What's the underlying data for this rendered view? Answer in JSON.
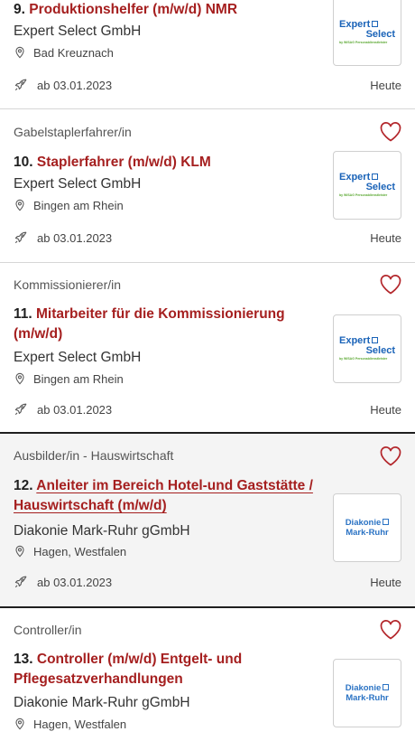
{
  "jobs": [
    {
      "category": "",
      "number": "9.",
      "title": "Produktionshelfer (m/w/d) NMR",
      "company": "Expert Select GmbH",
      "location": "Bad Kreuznach",
      "start": "ab 03.01.2023",
      "posted": "Heute",
      "logo_type": "expert-select"
    },
    {
      "category": "Gabelstaplerfahrer/in",
      "number": "10.",
      "title": "Staplerfahrer (m/w/d) KLM",
      "company": "Expert Select GmbH",
      "location": "Bingen am Rhein",
      "start": "ab 03.01.2023",
      "posted": "Heute",
      "logo_type": "expert-select"
    },
    {
      "category": "Kommissionierer/in",
      "number": "11.",
      "title": "Mitarbeiter für die Kommissionierung (m/w/d)",
      "company": "Expert Select GmbH",
      "location": "Bingen am Rhein",
      "start": "ab 03.01.2023",
      "posted": "Heute",
      "logo_type": "expert-select"
    },
    {
      "category": "Ausbilder/in - Hauswirtschaft",
      "number": "12.",
      "title": "Anleiter im Bereich Hotel-und Gaststätte / Hauswirtschaft (m/w/d)",
      "company": "Diakonie Mark-Ruhr gGmbH",
      "location": "Hagen, Westfalen",
      "start": "ab 03.01.2023",
      "posted": "Heute",
      "logo_type": "diakonie"
    },
    {
      "category": "Controller/in",
      "number": "13.",
      "title": "Controller (m/w/d) Entgelt- und Pflegesatzverhandlungen",
      "company": "Diakonie Mark-Ruhr gGmbH",
      "location": "Hagen, Westfalen",
      "start": "",
      "posted": "",
      "logo_type": "diakonie"
    }
  ],
  "logos": {
    "expert_line1": "Expert",
    "expert_line2": "Select",
    "expert_tag": "by WISAG Personaldienstleister",
    "diakonie_line1": "Diakonie",
    "diakonie_line2": "Mark-Ruhr"
  },
  "colors": {
    "title_link": "#a51f1f",
    "expert_blue": "#1a63b8",
    "diakonie_blue": "#2b73c4",
    "highlight_bg": "#f4f4f4"
  },
  "icons": {
    "favorite": "heart-outline-icon",
    "location": "map-pin-icon",
    "start": "rocket-icon"
  }
}
